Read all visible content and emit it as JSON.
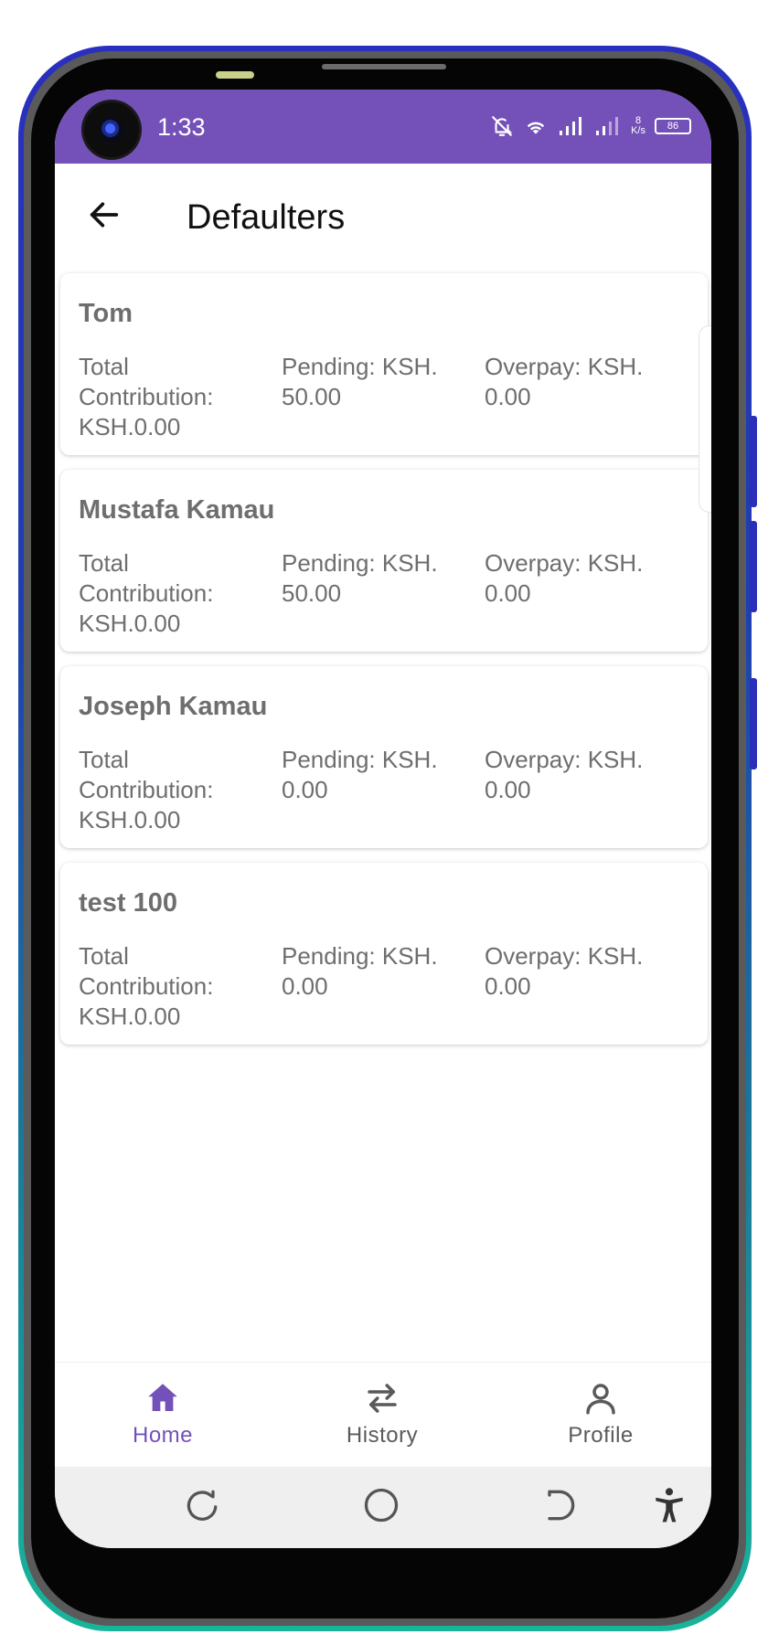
{
  "status_bar": {
    "time": "1:33",
    "net_speed_value": "8",
    "net_speed_unit": "K/s",
    "battery": "86",
    "color": "#7451b8"
  },
  "app_bar": {
    "title": "Defaulters",
    "back_icon": "arrow-left-icon"
  },
  "defaulters": [
    {
      "name": "Tom",
      "total_contribution": "Total\nContribution:\nKSH.0.00",
      "pending": "Pending: KSH.\n50.00",
      "overpay": "Overpay: KSH.\n0.00"
    },
    {
      "name": "Mustafa Kamau",
      "total_contribution": "Total\nContribution:\nKSH.0.00",
      "pending": "Pending: KSH.\n50.00",
      "overpay": "Overpay: KSH.\n0.00"
    },
    {
      "name": "Joseph Kamau",
      "total_contribution": "Total\nContribution:\nKSH.0.00",
      "pending": "Pending: KSH.\n0.00",
      "overpay": "Overpay: KSH.\n0.00"
    },
    {
      "name": "test 100",
      "total_contribution": "Total\nContribution:\nKSH.0.00",
      "pending": "Pending: KSH.\n0.00",
      "overpay": "Overpay: KSH.\n0.00"
    }
  ],
  "bottom_nav": {
    "items": [
      {
        "label": "Home",
        "icon": "home-icon",
        "active": true
      },
      {
        "label": "History",
        "icon": "swap-arrows-icon",
        "active": false
      },
      {
        "label": "Profile",
        "icon": "person-icon",
        "active": false
      }
    ],
    "active_color": "#7451b8"
  },
  "system_nav": {
    "icons": [
      "recents-icon",
      "home-circle-icon",
      "back-icon",
      "accessibility-icon"
    ]
  }
}
